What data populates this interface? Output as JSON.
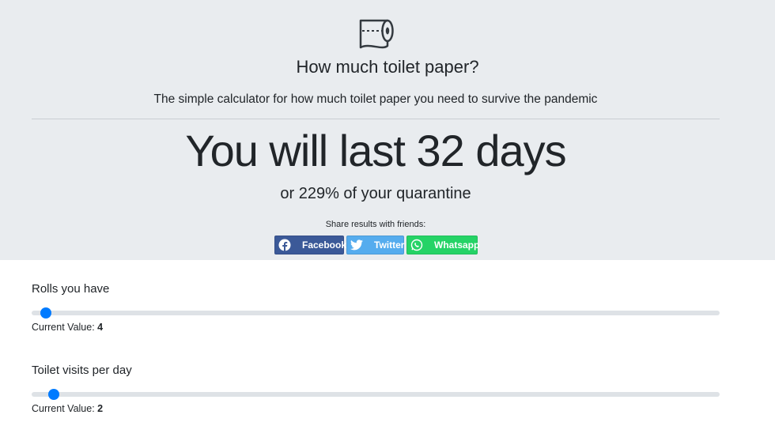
{
  "header": {
    "logo_icon": "toilet-paper-roll-icon",
    "title": "How much toilet paper?",
    "subtitle": "The simple calculator for how much toilet paper you need to survive the pandemic"
  },
  "result": {
    "prefix": "You will last ",
    "days": "32",
    "suffix": " days",
    "quarantine_prefix": "or ",
    "quarantine_percent": "229%",
    "quarantine_suffix": " of your quarantine"
  },
  "share": {
    "label": "Share results with friends:",
    "buttons": [
      {
        "label": "Facebook",
        "icon": "facebook-icon",
        "color": "#3b5998"
      },
      {
        "label": "Twitter",
        "icon": "twitter-icon",
        "color": "#55acee"
      },
      {
        "label": "Whatsapp",
        "icon": "whatsapp-icon",
        "color": "#25d366"
      }
    ]
  },
  "sliders": [
    {
      "label": "Rolls you have",
      "current_label": "Current Value:",
      "value": "4",
      "fraction": 0.021
    },
    {
      "label": "Toilet visits per day",
      "current_label": "Current Value:",
      "value": "2",
      "fraction": 0.032
    }
  ],
  "colors": {
    "hero_bg": "#e9ecef",
    "accent": "#007bff"
  }
}
